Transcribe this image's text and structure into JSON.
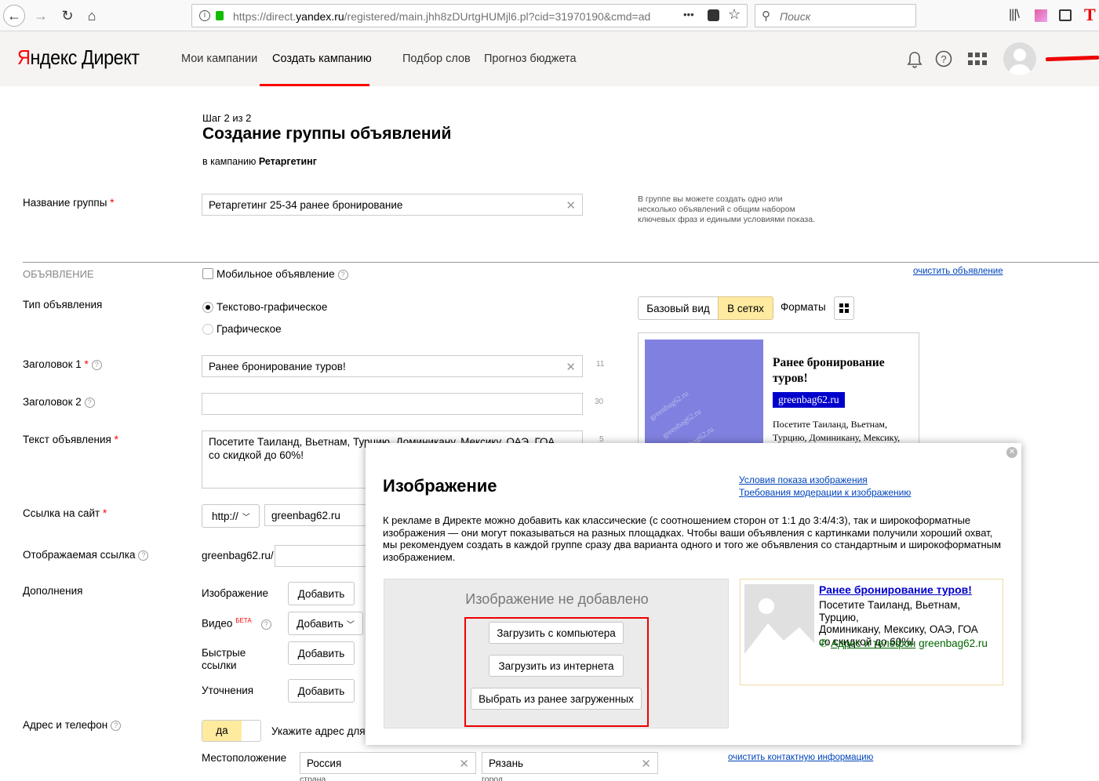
{
  "browser": {
    "url_prefix": "https://direct.",
    "url_domain": "yandex.ru",
    "url_rest": "/registered/main.jhh8zDUrtgHUMjl6.pl?cid=31970190&cmd=ad",
    "search_placeholder": "Поиск",
    "more_label": "•••"
  },
  "header": {
    "logo_first": "Я",
    "logo_rest": "ндекс Директ",
    "nav": [
      "Мои кампании",
      "Создать кампанию",
      "Подбор слов",
      "Прогноз бюджета"
    ],
    "active_nav": "Создать кампанию"
  },
  "page": {
    "step": "Шаг 2 из 2",
    "title": "Создание группы объявлений",
    "campaign_prefix": "в кампанию ",
    "campaign_name": "Ретаргетинг"
  },
  "group": {
    "label": "Название группы",
    "value": "Ретаргетинг 25-34 ранее бронирование",
    "hint": "В группе вы можете создать одно или несколько объявлений с общим набором ключевых фраз и едиными условиями показа."
  },
  "ad_section": {
    "label": "ОБЪЯВЛЕНИЕ",
    "mobile_label": "Мобильное объявление",
    "clear_link": "очистить объявление",
    "type_label": "Тип объявления",
    "type_options": [
      "Текстово-графическое",
      "Графическое"
    ],
    "selected_type": "Текстово-графическое",
    "preview_tabs": [
      "Базовый вид",
      "В сетях"
    ],
    "active_preview_tab": "В сетях",
    "formats_label": "Форматы",
    "title1_label": "Заголовок 1",
    "title1_value": "Ранее бронирование туров!",
    "title1_counter": "11",
    "title2_label": "Заголовок 2",
    "title2_value": "",
    "title2_counter": "30",
    "text_label": "Текст объявления",
    "text_line1": "Посетите Таиланд, Вьетнам, Турцию, Доминикану, Мексику, ОАЭ, ГОА",
    "text_line2": "со скидкой до 60%!",
    "text_counter": "5",
    "link_label": "Ссылка на сайт",
    "protocol": "http://",
    "link_value": "greenbag62.ru",
    "display_link_label": "Отображаемая ссылка",
    "display_link_prefix": "greenbag62.ru/",
    "extras_label": "Дополнения",
    "extras": [
      {
        "label": "Изображение",
        "button": "Добавить"
      },
      {
        "label": "Видео",
        "badge": "БЕТА",
        "button": "Добавить"
      },
      {
        "label": "Быстрые ссылки",
        "button": "Добавить"
      },
      {
        "label": "Уточнения",
        "button": "Добавить"
      }
    ],
    "address_label": "Адрес и телефон",
    "toggle_yes": "да",
    "address_hint": "Укажите адрес для",
    "location_label": "Местоположение",
    "country": "Россия",
    "country_caption": "страна",
    "city": "Рязань",
    "city_caption": "город",
    "clear_contacts": "очистить контактную информацию"
  },
  "preview": {
    "title": "Ранее бронирование туров!",
    "domain": "greenbag62.ru",
    "text": "Посетите Таиланд, Вьетнам, Турцию, Доминикану, Мексику,",
    "watermark": "greenbag62.ru"
  },
  "modal": {
    "title": "Изображение",
    "link1": "Условия показа изображения",
    "link2": "Требования модерации к изображению",
    "description": "К рекламе в Директе можно добавить как классические (с соотношением сторон от 1:1 до 3:4/4:3), так и широкоформатные изображения — они могут показываться на разных площадках. Чтобы ваши объявления с картинками получили хороший охват, мы рекомендуем создать в каждой группе сразу два варианта одного и того же объявления со стандартным и широкоформатным изображением.",
    "no_image": "Изображение не добавлено",
    "btn_computer": "Загрузить с компьютера",
    "btn_internet": "Загрузить из интернета",
    "btn_previous": "Выбрать из ранее загруженных",
    "ad_title": "Ранее бронирование туров!",
    "ad_text1": "Посетите Таиланд, Вьетнам, Турцию,",
    "ad_text2": "Доминикану, Мексику, ОАЭ, ГОА",
    "ad_text3": "со скидкой до 60%!",
    "ad_contacts": "Адрес и телефон",
    "ad_domain": "greenbag62.ru"
  },
  "colors": {
    "brand_red": "#ff0000",
    "link_blue": "#0044bb",
    "active_tab_yellow": "#ffeba0",
    "preview_domain_bg": "#0000cc",
    "image_placeholder": "#8080e0",
    "ad_domain_green": "#006600"
  }
}
